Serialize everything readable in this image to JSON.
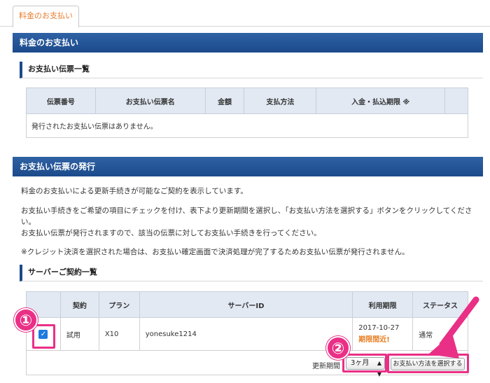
{
  "tabs": [
    {
      "label": "料金のお支払い"
    }
  ],
  "section_payment": {
    "title": "料金のお支払い"
  },
  "invoice_list": {
    "title": "お支払い伝票一覧",
    "columns": [
      "伝票番号",
      "お支払い伝票名",
      "金額",
      "支払方法",
      "入金・払込期限 ※"
    ],
    "empty_message": "発行されたお支払い伝票はありません。"
  },
  "section_issue": {
    "title": "お支払い伝票の発行",
    "paragraphs": [
      "料金のお支払いによる更新手続きが可能なご契約を表示しています。",
      "お支払い手続きをご希望の項目にチェックを付け、表下より更新期間を選択し、「お支払い方法を選択する」ボタンをクリックしてください。",
      "お支払い伝票が発行されますので、該当の伝票に対してお支払い手続きを行ってください。",
      "※クレジット決済を選択された場合は、お支払い確定画面で決済処理が完了するためお支払い伝票が発行されません。"
    ]
  },
  "server_list": {
    "title": "サーバーご契約一覧",
    "columns": [
      "",
      "契約",
      "プラン",
      "サーバーID",
      "利用期限",
      "ステータス"
    ],
    "rows": [
      {
        "checked": "✓",
        "contract": "試用",
        "plan": "X10",
        "server_id": "yonesuke1214",
        "expiry": "2017-10-27",
        "expiry_note": "期限間近!",
        "status": "通常"
      }
    ]
  },
  "renewal": {
    "label": "更新期間",
    "selected": "3ヶ月",
    "button": "お支払い方法を選択する"
  },
  "annotations": {
    "step1": "①",
    "step2": "②"
  },
  "colors": {
    "header_blue": "#1b4a8a",
    "accent_orange": "#e67e22",
    "annotation_pink": "#ea2f86",
    "tab_orange": "#e87a2a"
  }
}
